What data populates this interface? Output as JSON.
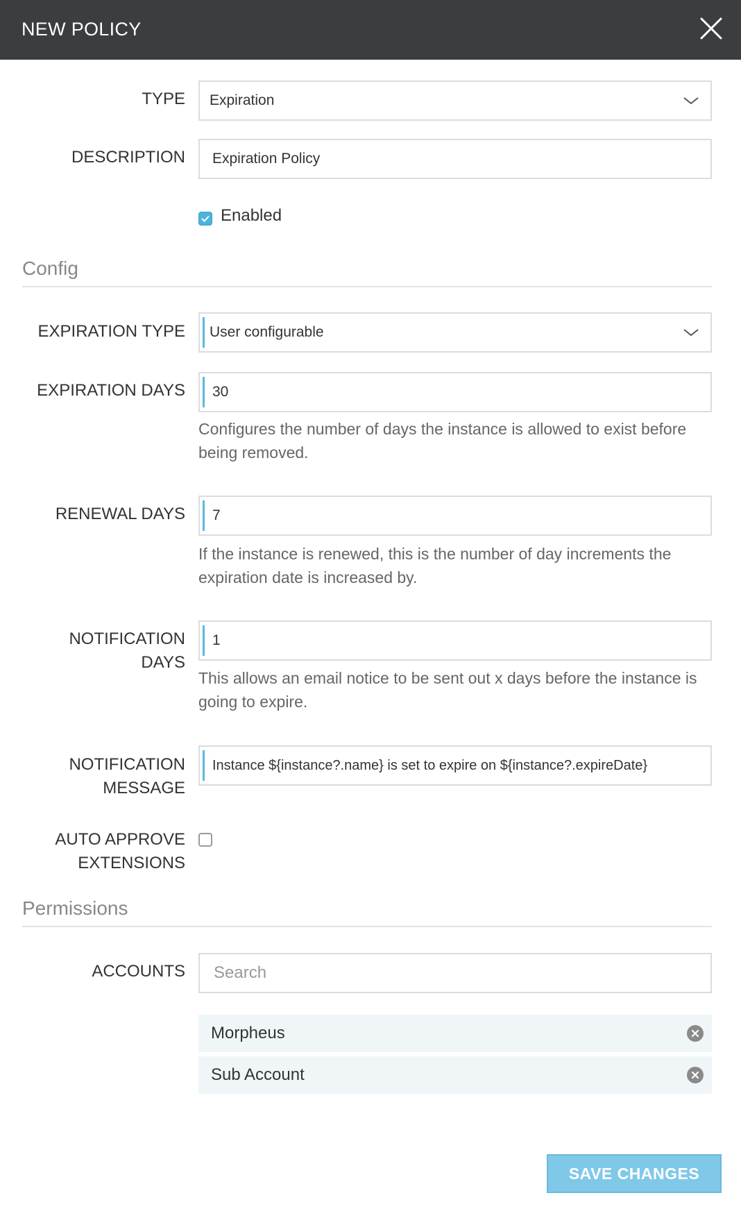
{
  "header": {
    "title": "NEW POLICY"
  },
  "form": {
    "type": {
      "label": "TYPE",
      "value": "Expiration"
    },
    "description": {
      "label": "DESCRIPTION",
      "value": "Expiration Policy"
    },
    "enabled": {
      "label": "Enabled",
      "checked": true
    }
  },
  "config": {
    "section_title": "Config",
    "expiration_type": {
      "label": "EXPIRATION TYPE",
      "value": "User configurable"
    },
    "expiration_days": {
      "label": "EXPIRATION DAYS",
      "value": "30",
      "help": "Configures the number of days the instance is allowed to exist before being removed."
    },
    "renewal_days": {
      "label": "RENEWAL DAYS",
      "value": "7",
      "help": "If the instance is renewed, this is the number of day increments the expiration date is increased by."
    },
    "notification_days": {
      "label_line1": "NOTIFICATION",
      "label_line2": "DAYS",
      "value": "1",
      "help": "This allows an email notice to be sent out x days before the instance is going to expire."
    },
    "notification_message": {
      "label_line1": "NOTIFICATION",
      "label_line2": "MESSAGE",
      "value": "Instance ${instance?.name} is set to expire on ${instance?.expireDate}"
    },
    "auto_approve": {
      "label_line1": "AUTO APPROVE",
      "label_line2": "EXTENSIONS",
      "checked": false
    }
  },
  "permissions": {
    "section_title": "Permissions",
    "accounts_label": "ACCOUNTS",
    "search_placeholder": "Search",
    "accounts": [
      "Morpheus",
      "Sub Account"
    ]
  },
  "footer": {
    "save_label": "SAVE CHANGES"
  },
  "colors": {
    "header_bg": "#3c3d3f",
    "accent": "#5bb8e0",
    "save_button": "#80c8e8",
    "account_bg": "#f0f6f8"
  },
  "icons": {
    "close": "close-icon",
    "dropdown": "chevron-down-icon",
    "check": "check-icon",
    "remove": "remove-circle-icon"
  }
}
